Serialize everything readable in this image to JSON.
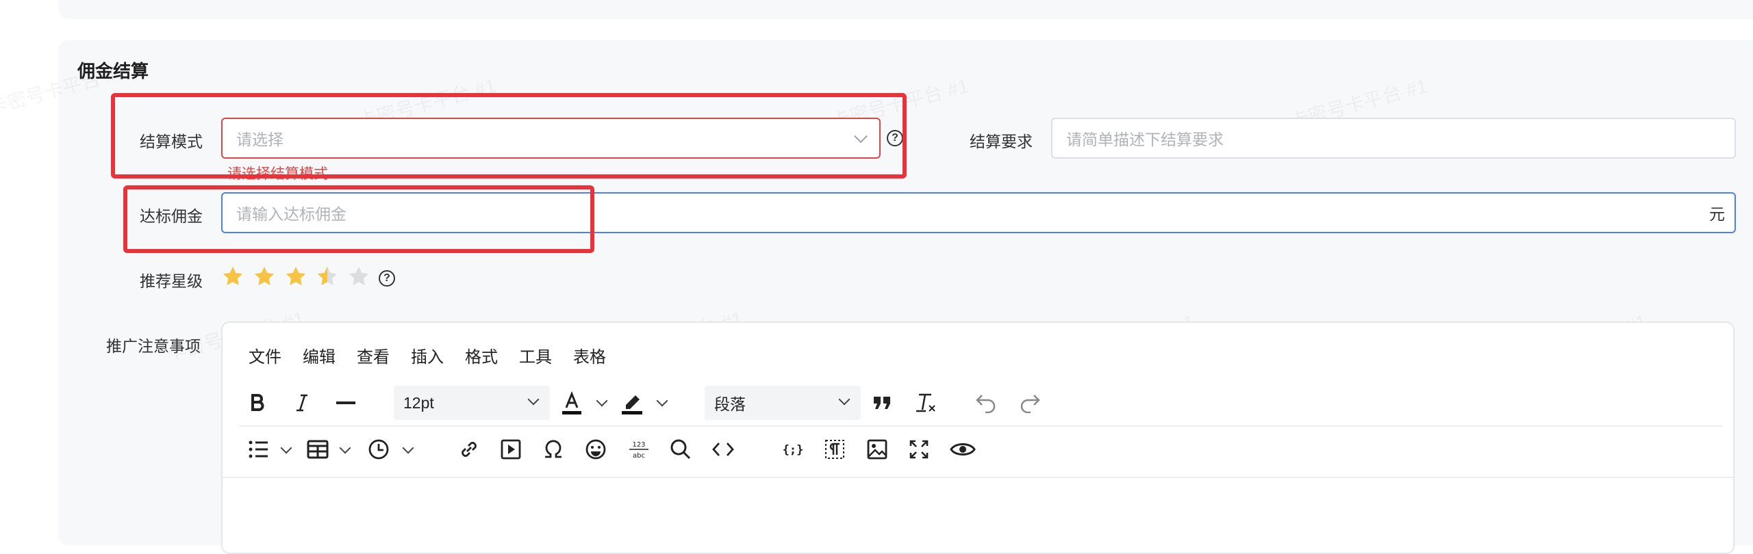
{
  "watermark": "卡密号卡平台 #1",
  "section": {
    "title": "佣金结算"
  },
  "settlement_mode": {
    "label": "结算模式",
    "placeholder": "请选择",
    "error": "请选择结算模式"
  },
  "settlement_req": {
    "label": "结算要求",
    "placeholder": "请简单描述下结算要求"
  },
  "commission": {
    "label": "达标佣金",
    "placeholder": "请输入达标佣金",
    "suffix": "元"
  },
  "rating": {
    "label": "推荐星级",
    "value": 3.5,
    "max": 5
  },
  "notes": {
    "label": "推广注意事项"
  },
  "editor": {
    "menu": [
      "文件",
      "编辑",
      "查看",
      "插入",
      "格式",
      "工具",
      "表格"
    ],
    "font_size": "12pt",
    "block_format": "段落"
  },
  "help_glyph": "?",
  "colors": {
    "error": "#e8333b",
    "focus": "#4a7dff",
    "star": "#f6c343",
    "star_empty": "#dcdde0"
  }
}
